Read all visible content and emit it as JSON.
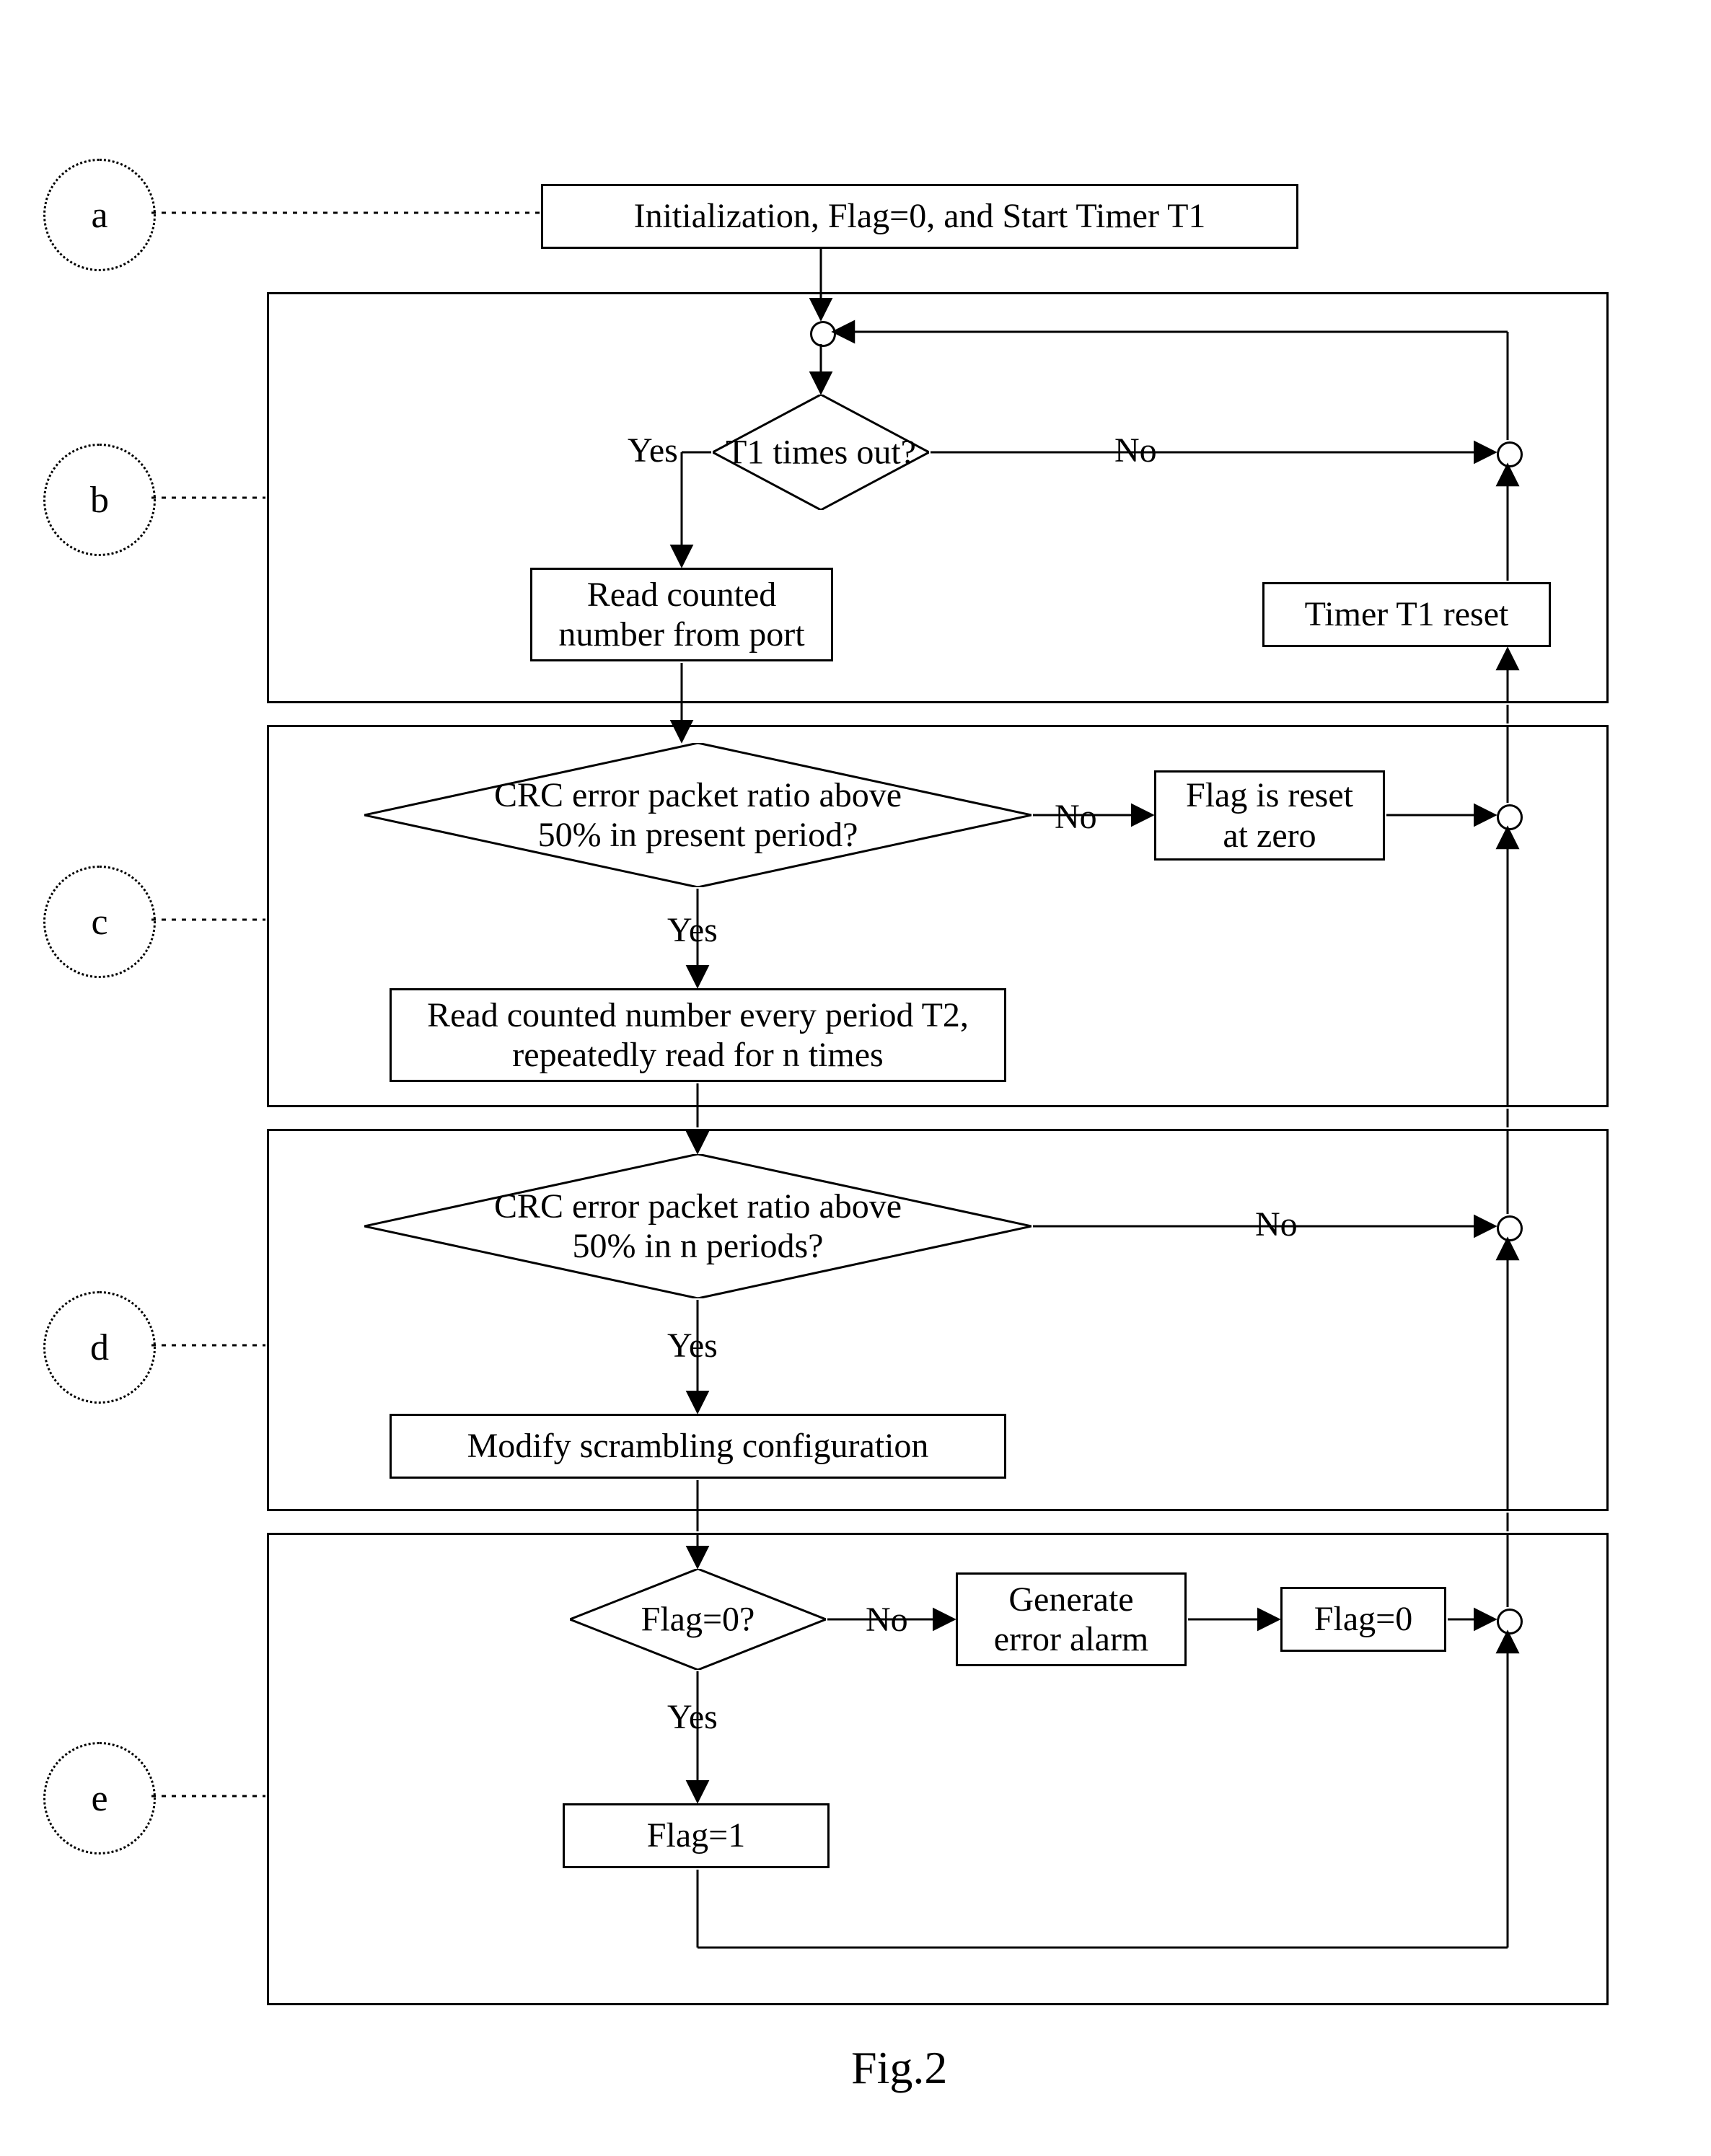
{
  "figure_caption": "Fig.2",
  "stage_labels": {
    "a": "a",
    "b": "b",
    "c": "c",
    "d": "d",
    "e": "e"
  },
  "nodes": {
    "init": "Initialization, Flag=0, and Start Timer T1",
    "t1_timeout": "T1 times out?",
    "read_port": "Read counted number from port",
    "timer_reset": "Timer T1 reset",
    "crc_present": "CRC error packet ratio above 50% in present period?",
    "flag_reset_zero": "Flag is reset at zero",
    "read_periods": "Read counted number every period T2, repeatedly read for n times",
    "crc_n_periods": "CRC error packet ratio above 50% in n periods?",
    "modify_scrambling": "Modify scrambling configuration",
    "flag_zero_q": "Flag=0?",
    "gen_alarm": "Generate error alarm",
    "set_flag_zero": "Flag=0",
    "set_flag_one": "Flag=1"
  },
  "edge_labels": {
    "yes": "Yes",
    "no": "No"
  }
}
